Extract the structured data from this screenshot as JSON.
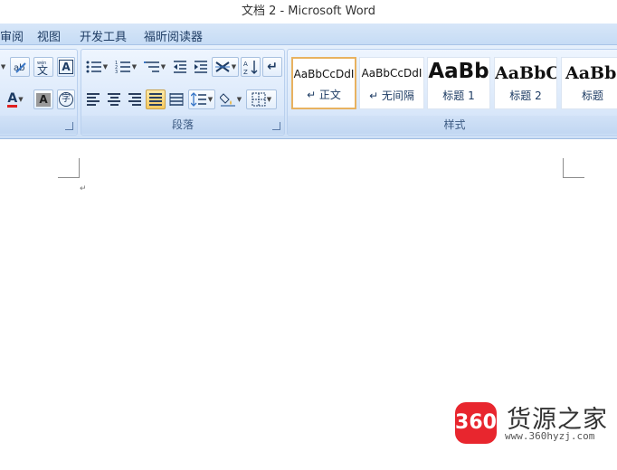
{
  "window": {
    "title": "文档 2 - Microsoft Word"
  },
  "menubar": {
    "items": [
      {
        "label": "审阅"
      },
      {
        "label": "视图"
      },
      {
        "label": "开发工具"
      },
      {
        "label": "福昕阅读器"
      }
    ]
  },
  "ribbon": {
    "font_group": {
      "buttons": [
        {
          "icon": "text-effects-icon"
        },
        {
          "icon": "phonetic-guide-icon"
        },
        {
          "glyph": "A",
          "icon": "character-border-icon"
        },
        {
          "glyph": "A",
          "icon": "font-color-icon",
          "color": "#e02020"
        },
        {
          "glyph": "A",
          "icon": "character-shading-icon"
        },
        {
          "glyph": "字",
          "icon": "enclose-characters-icon"
        }
      ]
    },
    "paragraph_group": {
      "label": "段落",
      "buttons": [
        {
          "icon": "bullets-icon"
        },
        {
          "icon": "numbering-icon"
        },
        {
          "icon": "multilevel-list-icon"
        },
        {
          "icon": "decrease-indent-icon"
        },
        {
          "icon": "increase-indent-icon"
        },
        {
          "icon": "chinese-layout-icon"
        },
        {
          "icon": "sort-icon",
          "glyph": "A Z"
        },
        {
          "icon": "show-formatting-marks-icon",
          "glyph": "↵"
        },
        {
          "icon": "align-left-icon"
        },
        {
          "icon": "center-icon"
        },
        {
          "icon": "align-right-icon"
        },
        {
          "icon": "justify-icon",
          "active": true
        },
        {
          "icon": "distributed-icon"
        },
        {
          "icon": "line-spacing-icon"
        },
        {
          "icon": "shading-icon"
        },
        {
          "icon": "borders-icon"
        }
      ]
    },
    "styles_group": {
      "label": "样式",
      "items": [
        {
          "sample": "AaBbCcDdI",
          "name": "↵ 正文",
          "selected": true
        },
        {
          "sample": "AaBbCcDdI",
          "name": "↵ 无间隔",
          "selected": false
        },
        {
          "sample": "AaBb",
          "name": "标题 1",
          "selected": false
        },
        {
          "sample": "AaBbC",
          "name": "标题 2",
          "selected": false
        },
        {
          "sample": "AaBbC",
          "name": "标题",
          "selected": false
        }
      ]
    }
  },
  "document": {
    "paragraph_mark": "↵"
  },
  "watermark": {
    "badge": "360",
    "title": "货源之家",
    "url": "www.360hyzj.com"
  },
  "colors": {
    "ribbon": "#d8e7fa",
    "active_button": "#f6c960",
    "selected_style_border": "#e8b260",
    "watermark_red": "#e8262e"
  }
}
